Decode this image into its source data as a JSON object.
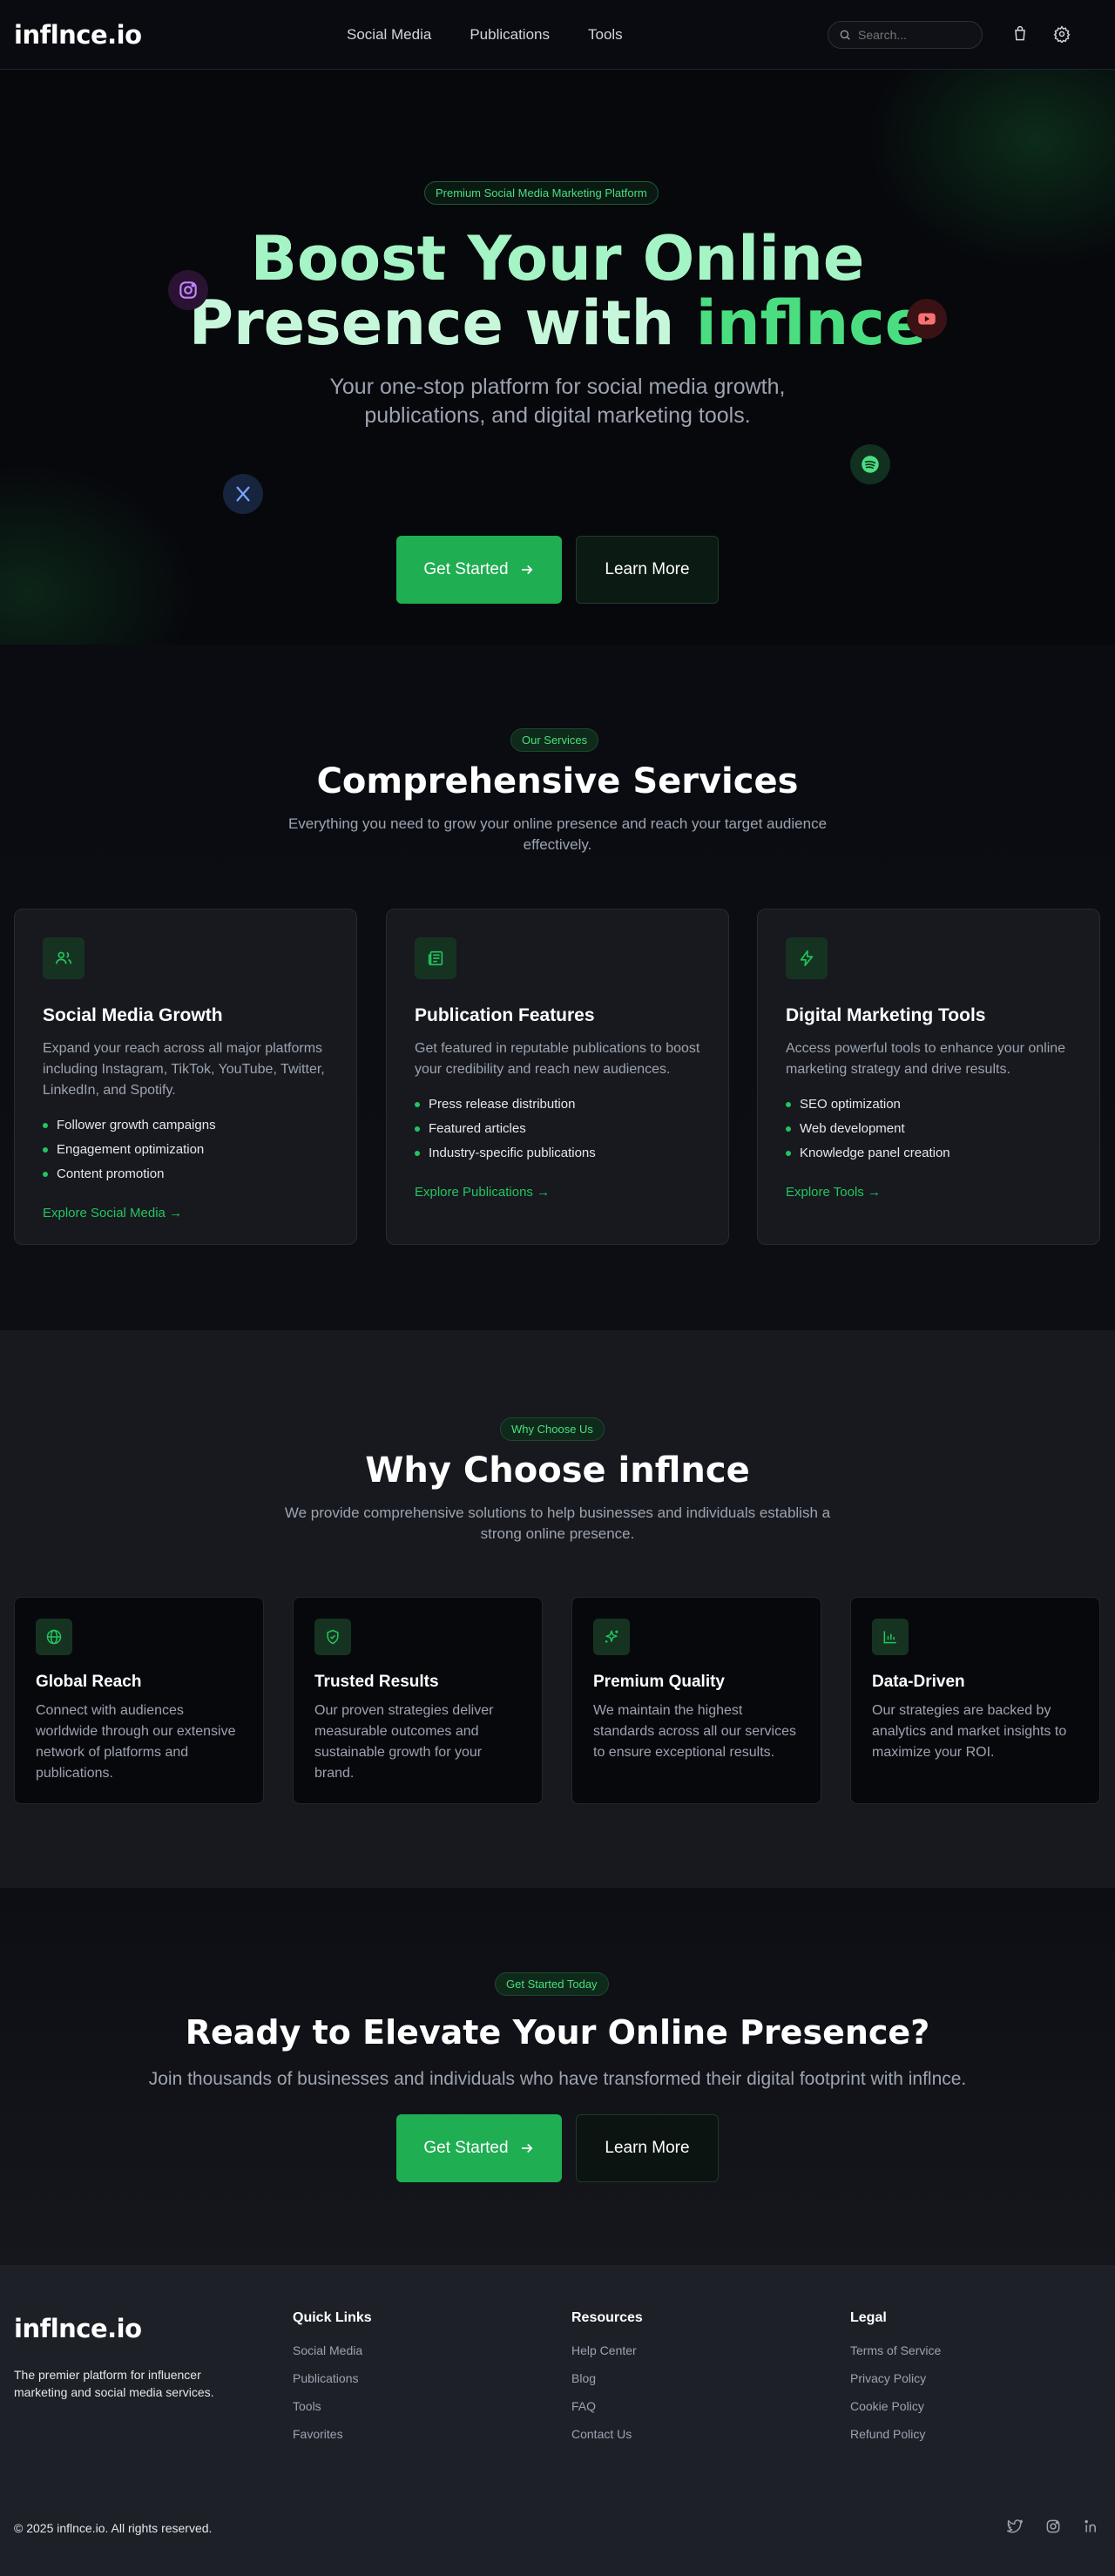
{
  "brand": {
    "logo": "inflnce.io",
    "accent": "#22c55e"
  },
  "header": {
    "nav": [
      "Social Media",
      "Publications",
      "Tools"
    ],
    "search_placeholder": "Search..."
  },
  "hero": {
    "pill": "Premium Social Media Marketing Platform",
    "title_line1": "Boost Your Online",
    "title_line2_prefix": "Presence with ",
    "title_brand": "inflnce",
    "subtitle_line1": "Your one-stop platform for social media growth,",
    "subtitle_line2": "publications, and digital marketing tools.",
    "primary_button": "Get Started",
    "secondary_button": "Learn More",
    "floating_icons": [
      "instagram-icon",
      "youtube-icon",
      "x-icon",
      "spotify-icon"
    ]
  },
  "services": {
    "pill": "Our Services",
    "title": "Comprehensive Services",
    "subtitle_line1": "Everything you need to grow your online presence and reach your target audience",
    "subtitle_line2": "effectively.",
    "cards": [
      {
        "icon": "users-icon",
        "title": "Social Media Growth",
        "description": "Expand your reach across all major platforms including Instagram, TikTok, YouTube, Twitter, LinkedIn, and Spotify.",
        "features": [
          "Follower growth campaigns",
          "Engagement optimization",
          "Content promotion"
        ],
        "link": "Explore Social Media →"
      },
      {
        "icon": "newspaper-icon",
        "title": "Publication Features",
        "description": "Get featured in reputable publications to boost your credibility and reach new audiences.",
        "features": [
          "Press release distribution",
          "Featured articles",
          "Industry-specific publications"
        ],
        "link": "Explore Publications →"
      },
      {
        "icon": "lightning-icon",
        "title": "Digital Marketing Tools",
        "description": "Access powerful tools to enhance your online marketing strategy and drive results.",
        "features": [
          "SEO optimization",
          "Web development",
          "Knowledge panel creation"
        ],
        "link": "Explore Tools →"
      }
    ]
  },
  "why": {
    "pill": "Why Choose Us",
    "title": "Why Choose inflnce",
    "subtitle_line1": "We provide comprehensive solutions to help businesses and individuals establish a",
    "subtitle_line2": "strong online presence.",
    "cards": [
      {
        "icon": "globe-icon",
        "title": "Global Reach",
        "description": "Connect with audiences worldwide through our extensive network of platforms and publications."
      },
      {
        "icon": "shield-check-icon",
        "title": "Trusted Results",
        "description": "Our proven strategies deliver measurable outcomes and sustainable growth for your brand."
      },
      {
        "icon": "sparkles-icon",
        "title": "Premium Quality",
        "description": "We maintain the highest standards across all our services to ensure exceptional results."
      },
      {
        "icon": "bar-chart-icon",
        "title": "Data-Driven",
        "description": "Our strategies are backed by analytics and market insights to maximize your ROI."
      }
    ]
  },
  "cta": {
    "pill": "Get Started Today",
    "title": "Ready to Elevate Your Online Presence?",
    "subtitle": "Join thousands of businesses and individuals who have transformed their digital footprint with inflnce.",
    "primary_button": "Get Started",
    "secondary_button": "Learn More"
  },
  "footer": {
    "logo": "inflnce.io",
    "description": "The premier platform for influencer marketing and social media services.",
    "columns": [
      {
        "title": "Quick Links",
        "links": [
          "Social Media",
          "Publications",
          "Tools",
          "Favorites"
        ]
      },
      {
        "title": "Resources",
        "links": [
          "Help Center",
          "Blog",
          "FAQ",
          "Contact Us"
        ]
      },
      {
        "title": "Legal",
        "links": [
          "Terms of Service",
          "Privacy Policy",
          "Cookie Policy",
          "Refund Policy"
        ]
      }
    ],
    "copyright": "© 2025 inflnce.io. All rights reserved.",
    "social_icons": [
      "twitter-icon",
      "instagram-icon",
      "linkedin-icon"
    ]
  }
}
